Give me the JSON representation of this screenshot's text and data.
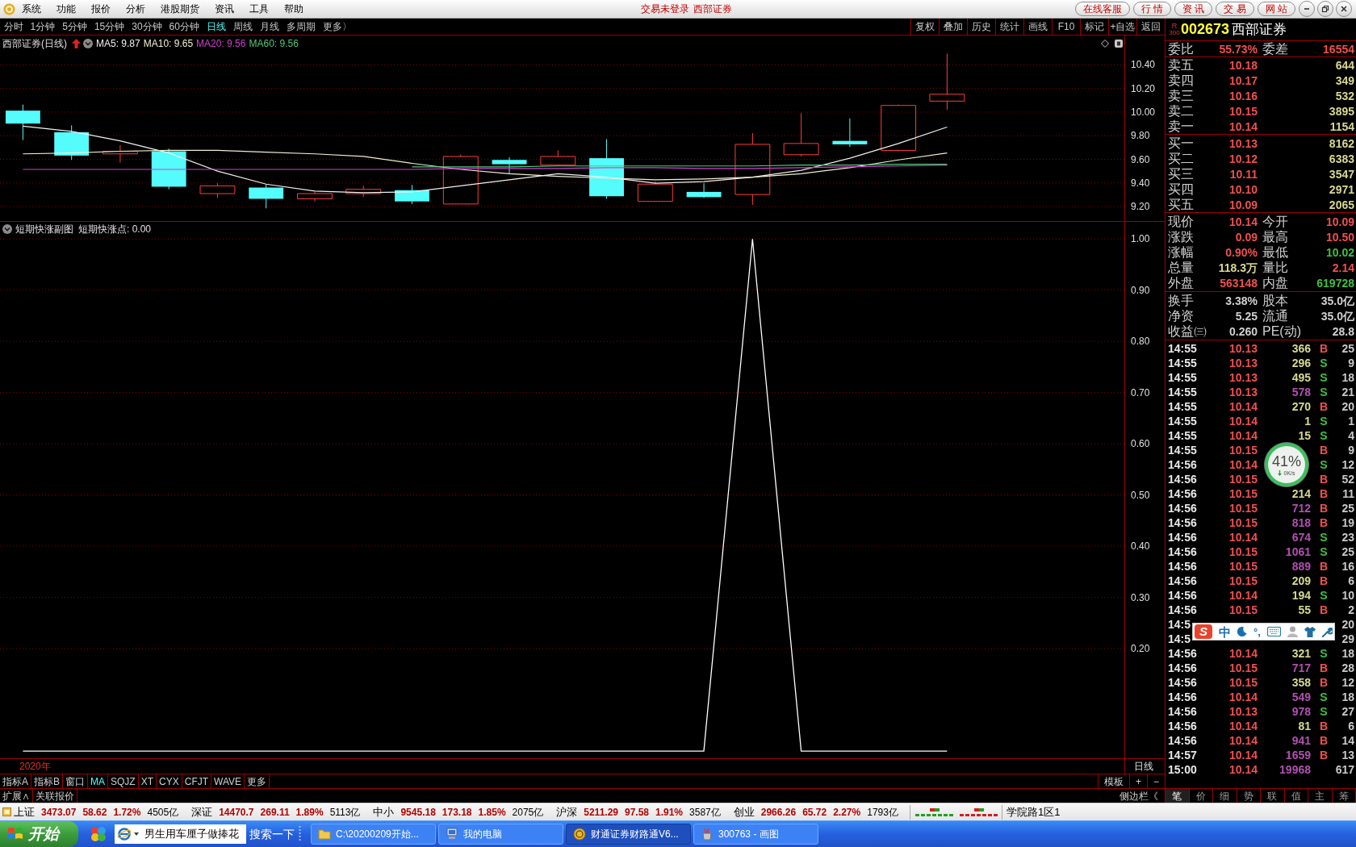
{
  "title_bar": {
    "menus": [
      "系统",
      "功能",
      "报价",
      "分析",
      "港股期货",
      "资讯",
      "工具",
      "帮助"
    ],
    "login_status": "交易未登录",
    "broker": "西部证券",
    "links": [
      "在线客服",
      "行 情",
      "资 讯",
      "交 易",
      "网 站"
    ]
  },
  "period_toolbar": {
    "periods": [
      {
        "label": "分时",
        "selected": false
      },
      {
        "label": "1分钟",
        "selected": false
      },
      {
        "label": "5分钟",
        "selected": false
      },
      {
        "label": "15分钟",
        "selected": false
      },
      {
        "label": "30分钟",
        "selected": false
      },
      {
        "label": "60分钟",
        "selected": false
      },
      {
        "label": "日线",
        "selected": true
      },
      {
        "label": "周线",
        "selected": false
      },
      {
        "label": "月线",
        "selected": false
      },
      {
        "label": "多周期",
        "selected": false
      },
      {
        "label": "更多〉",
        "selected": false
      }
    ],
    "tools": [
      "复权",
      "叠加",
      "历史",
      "统计",
      "画线",
      "F10",
      "标记",
      "+自选",
      "返回"
    ]
  },
  "price_chart": {
    "title": "西部证券(日线)",
    "moving_averages": [
      {
        "label": "MA5: 9.87",
        "color": "#f0f0f0"
      },
      {
        "label": "MA10: 9.65",
        "color": "#f0f0d0"
      },
      {
        "label": "MA20: 9.56",
        "color": "#d040d0"
      },
      {
        "label": "MA60: 9.56",
        "color": "#50c878"
      }
    ],
    "price_axis": [
      "10.40",
      "10.20",
      "10.00",
      "9.80",
      "9.60",
      "9.40",
      "9.20"
    ]
  },
  "indicator": {
    "title": "短期快涨副图",
    "reading": "短期快涨点: 0.00",
    "chart_data": {
      "type": "line",
      "series": [
        {
          "color": "#ffffff",
          "values": [
            0,
            0,
            0,
            0,
            0,
            0,
            0,
            0,
            0,
            0,
            0,
            0,
            0,
            0,
            0,
            1,
            0,
            0,
            0,
            0
          ]
        }
      ],
      "ylim": [
        -0.044,
        1.005
      ],
      "yticks": [
        {
          "value": 1,
          "label": "1.00"
        },
        {
          "value": 0.9,
          "label": "0.90"
        },
        {
          "value": 0.8,
          "label": "0.80"
        },
        {
          "value": 0.7,
          "label": "0.70"
        },
        {
          "value": 0.6,
          "label": "0.60"
        },
        {
          "value": 0.5,
          "label": "0.50"
        },
        {
          "value": 0.4,
          "label": "0.40"
        },
        {
          "value": 0.3,
          "label": "0.30"
        },
        {
          "value": 0.2,
          "label": "0.20"
        }
      ],
      "grid": true
    }
  },
  "date_axis": {
    "year": "2020年",
    "period": "日线"
  },
  "indicator_tabs": [
    {
      "label": "指标A",
      "selected": false
    },
    {
      "label": "指标B",
      "selected": false
    },
    {
      "label": "窗口",
      "selected": false
    },
    {
      "label": "MA",
      "selected": true
    },
    {
      "label": "SQJZ",
      "selected": false
    },
    {
      "label": "XT",
      "selected": false
    },
    {
      "label": "CYX",
      "selected": false
    },
    {
      "label": "CFJT",
      "selected": false
    },
    {
      "label": "WAVE",
      "selected": false
    },
    {
      "label": "更多",
      "selected": false
    }
  ],
  "template_controls": [
    "模板",
    "+",
    "−"
  ],
  "extension_tabs": [
    "扩展∧",
    "关联报价"
  ],
  "sidebar_toggle": "侧边栏《",
  "quote_panel": {
    "badge": [
      "R",
      "300"
    ],
    "code": "002673",
    "name": "西部证券",
    "order_ratio": [
      {
        "label": "委比",
        "value": "55.73%"
      },
      {
        "label": "委差",
        "value": "16554"
      }
    ],
    "asks": [
      {
        "label": "卖五",
        "price": "10.18",
        "volume": "644"
      },
      {
        "label": "卖四",
        "price": "10.17",
        "volume": "349"
      },
      {
        "label": "卖三",
        "price": "10.16",
        "volume": "532"
      },
      {
        "label": "卖二",
        "price": "10.15",
        "volume": "3895"
      },
      {
        "label": "卖一",
        "price": "10.14",
        "volume": "1154"
      }
    ],
    "bids": [
      {
        "label": "买一",
        "price": "10.13",
        "volume": "8162"
      },
      {
        "label": "买二",
        "price": "10.12",
        "volume": "6383"
      },
      {
        "label": "买三",
        "price": "10.11",
        "volume": "3547"
      },
      {
        "label": "买四",
        "price": "10.10",
        "volume": "2971"
      },
      {
        "label": "买五",
        "price": "10.09",
        "volume": "2065"
      }
    ],
    "stats": [
      {
        "label": "现价",
        "value": "10.14",
        "color": "#f05050"
      },
      {
        "label": "今开",
        "value": "10.09",
        "color": "#f05050"
      },
      {
        "label": "涨跌",
        "value": "0.09",
        "color": "#f05050"
      },
      {
        "label": "最高",
        "value": "10.50",
        "color": "#f05050"
      },
      {
        "label": "涨幅",
        "value": "0.90%",
        "color": "#f05050"
      },
      {
        "label": "最低",
        "value": "10.02",
        "color": "#40c040"
      },
      {
        "label": "总量",
        "value": "118.3万",
        "color": "#d8d890"
      },
      {
        "label": "量比",
        "value": "2.14",
        "color": "#f05050"
      },
      {
        "label": "外盘",
        "value": "563148",
        "color": "#f05050"
      },
      {
        "label": "内盘",
        "value": "619728",
        "color": "#40c040"
      }
    ],
    "capital": [
      {
        "label": "换手",
        "value": "3.38%"
      },
      {
        "label": "股本",
        "value": "35.0亿"
      },
      {
        "label": "净资",
        "value": "5.25"
      },
      {
        "label": "流通",
        "value": "35.0亿"
      },
      {
        "label": "收益㈢",
        "value": "0.260"
      },
      {
        "label": "PE(动)",
        "value": "28.8"
      }
    ],
    "trades": [
      {
        "time": "14:55",
        "price": "10.13",
        "volume": {
          "text": "366",
          "color": "#d8d890"
        },
        "side": {
          "text": "B",
          "color": "#f05050"
        },
        "count": "25"
      },
      {
        "time": "14:55",
        "price": "10.13",
        "volume": {
          "text": "296",
          "color": "#d8d890"
        },
        "side": {
          "text": "S",
          "color": "#40c040"
        },
        "count": "9"
      },
      {
        "time": "14:55",
        "price": "10.13",
        "volume": {
          "text": "495",
          "color": "#d8d890"
        },
        "side": {
          "text": "S",
          "color": "#40c040"
        },
        "count": "18"
      },
      {
        "time": "14:55",
        "price": "10.13",
        "volume": {
          "text": "578",
          "color": "#b050b0"
        },
        "side": {
          "text": "S",
          "color": "#40c040"
        },
        "count": "21"
      },
      {
        "time": "14:55",
        "price": "10.14",
        "volume": {
          "text": "270",
          "color": "#d8d890"
        },
        "side": {
          "text": "B",
          "color": "#f05050"
        },
        "count": "20"
      },
      {
        "time": "14:55",
        "price": "10.14",
        "volume": {
          "text": "1",
          "color": "#d8d890"
        },
        "side": {
          "text": "S",
          "color": "#40c040"
        },
        "count": "1"
      },
      {
        "time": "14:55",
        "price": "10.14",
        "volume": {
          "text": "15",
          "color": "#d8d890"
        },
        "side": {
          "text": "S",
          "color": "#40c040"
        },
        "count": "4"
      },
      {
        "time": "14:55",
        "price": "10.15",
        "side": {
          "text": "B",
          "color": "#f05050"
        },
        "count": "9"
      },
      {
        "time": "14:56",
        "price": "10.14",
        "side": {
          "text": "S",
          "color": "#40c040"
        },
        "count": "12"
      },
      {
        "time": "14:56",
        "price": "10.15",
        "side": {
          "text": "B",
          "color": "#f05050"
        },
        "count": "52"
      },
      {
        "time": "14:56",
        "price": "10.15",
        "volume": {
          "text": "214",
          "color": "#d8d890"
        },
        "side": {
          "text": "B",
          "color": "#f05050"
        },
        "count": "11"
      },
      {
        "time": "14:56",
        "price": "10.15",
        "volume": {
          "text": "712",
          "color": "#b050b0"
        },
        "side": {
          "text": "B",
          "color": "#f05050"
        },
        "count": "25"
      },
      {
        "time": "14:56",
        "price": "10.15",
        "volume": {
          "text": "818",
          "color": "#b050b0"
        },
        "side": {
          "text": "B",
          "color": "#f05050"
        },
        "count": "19"
      },
      {
        "time": "14:56",
        "price": "10.14",
        "volume": {
          "text": "674",
          "color": "#b050b0"
        },
        "side": {
          "text": "S",
          "color": "#40c040"
        },
        "count": "23"
      },
      {
        "time": "14:56",
        "price": "10.15",
        "volume": {
          "text": "1061",
          "color": "#b050b0"
        },
        "side": {
          "text": "S",
          "color": "#40c040"
        },
        "count": "25"
      },
      {
        "time": "14:56",
        "price": "10.15",
        "volume": {
          "text": "889",
          "color": "#b050b0"
        },
        "side": {
          "text": "B",
          "color": "#f05050"
        },
        "count": "16"
      },
      {
        "time": "14:56",
        "price": "10.15",
        "volume": {
          "text": "209",
          "color": "#d8d890"
        },
        "side": {
          "text": "B",
          "color": "#f05050"
        },
        "count": "6"
      },
      {
        "time": "14:56",
        "price": "10.14",
        "volume": {
          "text": "194",
          "color": "#d8d890"
        },
        "side": {
          "text": "S",
          "color": "#40c040"
        },
        "count": "10"
      },
      {
        "time": "14:56",
        "price": "10.15",
        "volume": {
          "text": "55",
          "color": "#d8d890"
        },
        "side": {
          "text": "B",
          "color": "#f05050"
        },
        "count": "2"
      },
      {
        "time": "14:5",
        "count": "20"
      },
      {
        "time": "14:5",
        "count": "29"
      },
      {
        "time": "14:56",
        "price": "10.14",
        "volume": {
          "text": "321",
          "color": "#d8d890"
        },
        "side": {
          "text": "S",
          "color": "#40c040"
        },
        "count": "18"
      },
      {
        "time": "14:56",
        "price": "10.15",
        "volume": {
          "text": "717",
          "color": "#b050b0"
        },
        "side": {
          "text": "B",
          "color": "#f05050"
        },
        "count": "28"
      },
      {
        "time": "14:56",
        "price": "10.15",
        "volume": {
          "text": "358",
          "color": "#d8d890"
        },
        "side": {
          "text": "B",
          "color": "#f05050"
        },
        "count": "12"
      },
      {
        "time": "14:56",
        "price": "10.14",
        "volume": {
          "text": "549",
          "color": "#b050b0"
        },
        "side": {
          "text": "S",
          "color": "#40c040"
        },
        "count": "18"
      },
      {
        "time": "14:56",
        "price": "10.13",
        "volume": {
          "text": "978",
          "color": "#b050b0"
        },
        "side": {
          "text": "S",
          "color": "#40c040"
        },
        "count": "27"
      },
      {
        "time": "14:56",
        "price": "10.14",
        "volume": {
          "text": "81",
          "color": "#d8d890"
        },
        "side": {
          "text": "B",
          "color": "#f05050"
        },
        "count": "6"
      },
      {
        "time": "14:56",
        "price": "10.14",
        "volume": {
          "text": "941",
          "color": "#b050b0"
        },
        "side": {
          "text": "B",
          "color": "#f05050"
        },
        "count": "14"
      },
      {
        "time": "14:57",
        "price": "10.14",
        "volume": {
          "text": "1659",
          "color": "#b050b0"
        },
        "side": {
          "text": "B",
          "color": "#f05050"
        },
        "count": "13"
      },
      {
        "time": "15:00",
        "price": "10.14",
        "volume": {
          "text": "19968",
          "color": "#b050b0"
        },
        "count": "617"
      }
    ],
    "tabs": [
      {
        "label": "笔",
        "selected": true
      },
      {
        "label": "价",
        "selected": false
      },
      {
        "label": "细",
        "selected": false
      },
      {
        "label": "势",
        "selected": false
      },
      {
        "label": "联",
        "selected": false
      },
      {
        "label": "值",
        "selected": false
      },
      {
        "label": "主",
        "selected": false
      },
      {
        "label": "筹",
        "selected": false
      }
    ]
  },
  "floating_widget": {
    "percent": "41%",
    "speed": "0K/s"
  },
  "ime_toolbar": {
    "logo": "S",
    "mode": "中",
    "punctuation": "°,"
  },
  "status_bar": {
    "indices": [
      {
        "name": "上证",
        "value": "3473.07",
        "change": "58.62",
        "percent": "1.72%",
        "amount": "4505亿"
      },
      {
        "name": "深证",
        "value": "14470.7",
        "change": "269.11",
        "percent": "1.89%",
        "amount": "5113亿"
      },
      {
        "name": "中小",
        "value": "9545.18",
        "change": "173.18",
        "percent": "1.85%",
        "amount": "2075亿"
      },
      {
        "name": "沪深",
        "value": "5211.29",
        "change": "97.58",
        "percent": "1.91%",
        "amount": "3587亿"
      },
      {
        "name": "创业",
        "value": "2966.26",
        "change": "65.72",
        "percent": "2.27%",
        "amount": "1793亿"
      }
    ],
    "location": "学院路1区1"
  },
  "taskbar": {
    "start": "开始",
    "search_text": "男生用车厘子做捧花",
    "search_button": "搜索一下",
    "tasks": [
      {
        "label": "C:\\20200209开始...",
        "kind": "folder",
        "selected": false
      },
      {
        "label": "我的电脑",
        "kind": "computer",
        "selected": false
      },
      {
        "label": "财通证券财路通V6...",
        "kind": "app",
        "selected": true
      },
      {
        "label": "300763 - 画图",
        "kind": "paint",
        "selected": false
      }
    ]
  }
}
